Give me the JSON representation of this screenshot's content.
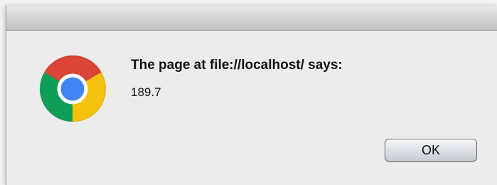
{
  "dialog": {
    "title": "The page at file://localhost/ says:",
    "message": "189.7",
    "ok_label": "OK"
  },
  "icon": {
    "name": "chrome-icon",
    "colors": {
      "red": "#db4437",
      "yellow": "#f4c20d",
      "green": "#0f9d58",
      "blue": "#4285f4",
      "white": "#ffffff"
    }
  }
}
